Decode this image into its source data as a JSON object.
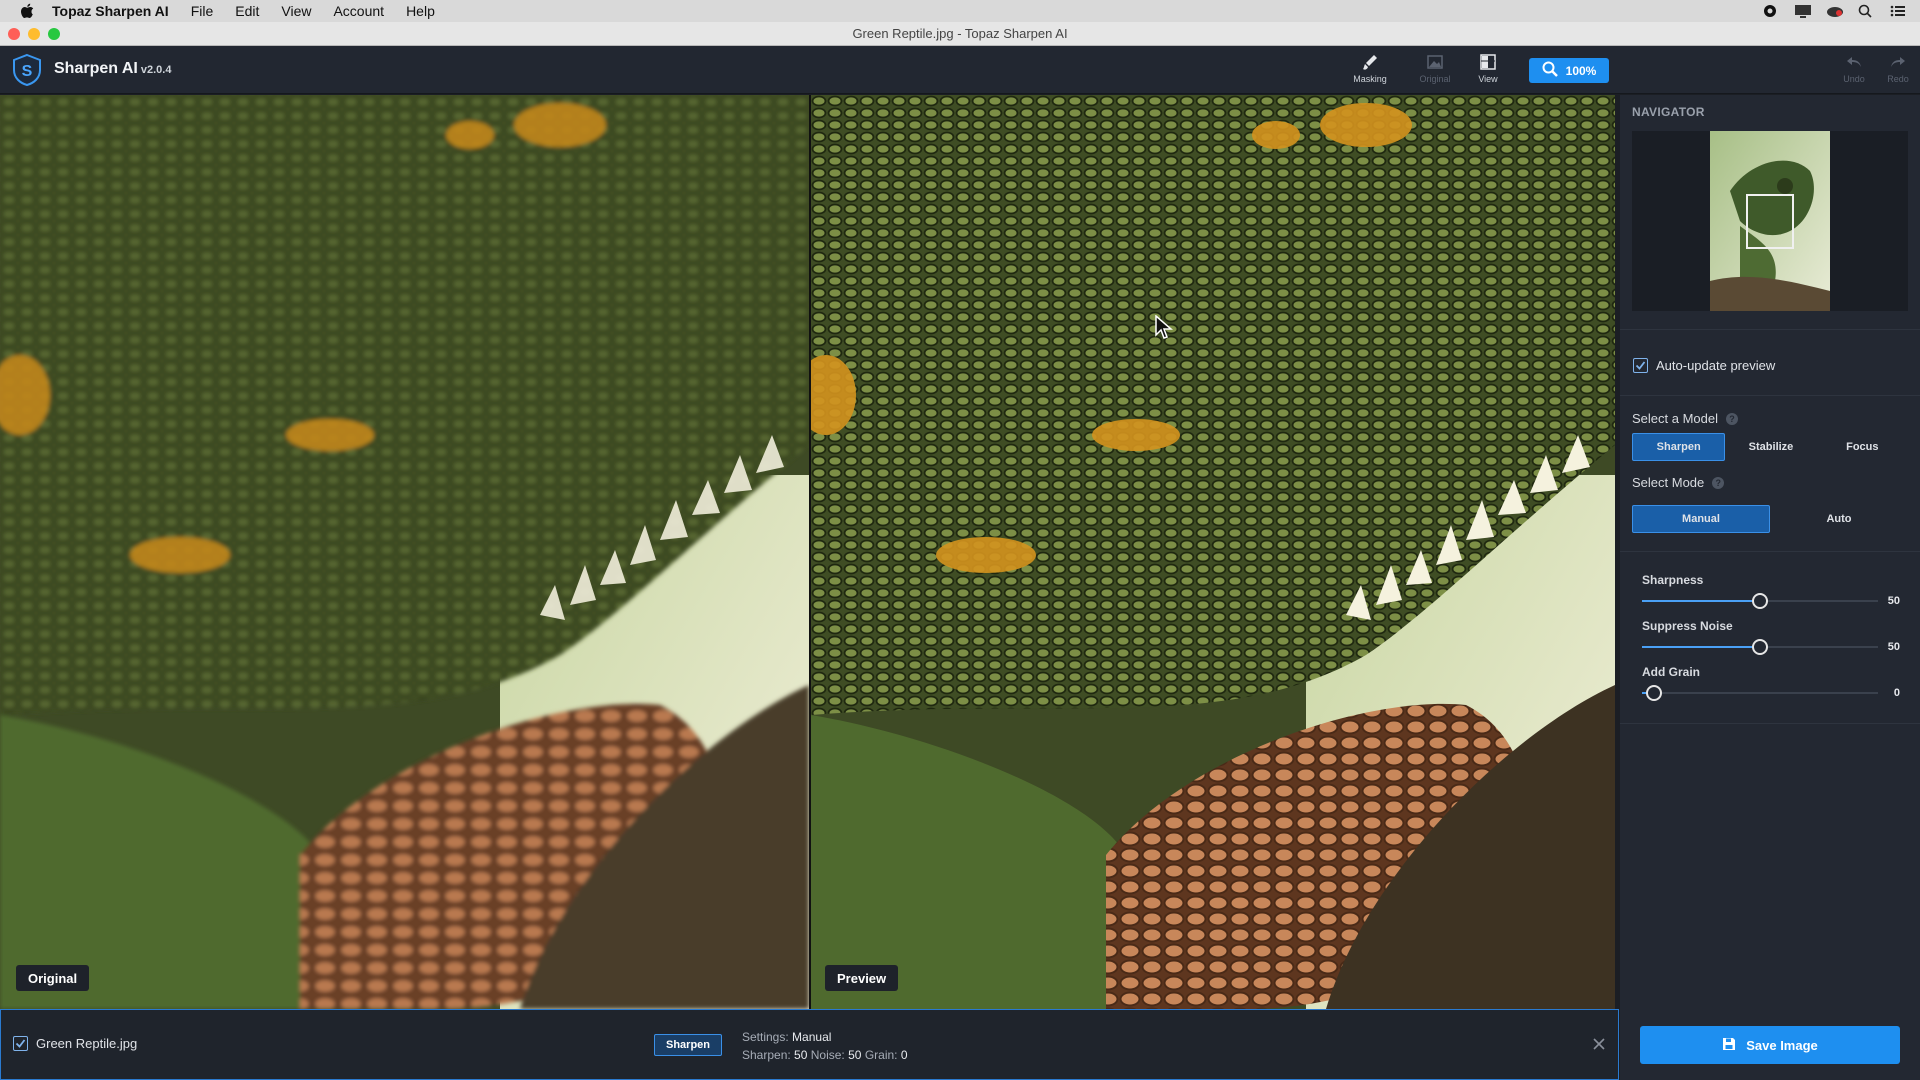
{
  "menubar": {
    "app_name": "Topaz Sharpen AI",
    "items": [
      "File",
      "Edit",
      "View",
      "Account",
      "Help"
    ]
  },
  "window": {
    "title": "Green Reptile.jpg - Topaz Sharpen AI"
  },
  "toolbar": {
    "brand": "Sharpen AI",
    "version": "v2.0.4",
    "tools": [
      {
        "label": "Masking",
        "icon": "brush-icon",
        "enabled": true
      },
      {
        "label": "Original",
        "icon": "image-icon",
        "enabled": false
      },
      {
        "label": "View",
        "icon": "split-view-icon",
        "enabled": true
      }
    ],
    "zoom": "100%",
    "undo_label": "Undo",
    "redo_label": "Redo"
  },
  "panels": {
    "original_label": "Original",
    "preview_label": "Preview"
  },
  "sidebar": {
    "navigator_title": "NAVIGATOR",
    "auto_update_label": "Auto-update preview",
    "auto_update_checked": true,
    "model_label": "Select a Model",
    "models": [
      "Sharpen",
      "Stabilize",
      "Focus"
    ],
    "selected_model": "Sharpen",
    "mode_label": "Select Mode",
    "modes": [
      "Manual",
      "Auto"
    ],
    "selected_mode": "Manual",
    "sliders": [
      {
        "label": "Sharpness",
        "value": 50,
        "fraction": 0.5
      },
      {
        "label": "Suppress Noise",
        "value": 50,
        "fraction": 0.5
      },
      {
        "label": "Add Grain",
        "value": 0,
        "fraction": 0.05
      }
    ]
  },
  "filebar": {
    "file_name": "Green Reptile.jpg",
    "checked": true,
    "model_tag": "Sharpen",
    "settings_prefix": "Settings:",
    "settings_mode": "Manual",
    "sharpen_label": "Sharpen:",
    "sharpen_value": "50",
    "noise_label": "Noise:",
    "noise_value": "50",
    "grain_label": "Grain:",
    "grain_value": "0"
  },
  "save_button": "Save Image",
  "colors": {
    "accent": "#1e8ff0",
    "active_segment": "#1a5fa8",
    "background": "#232832"
  }
}
